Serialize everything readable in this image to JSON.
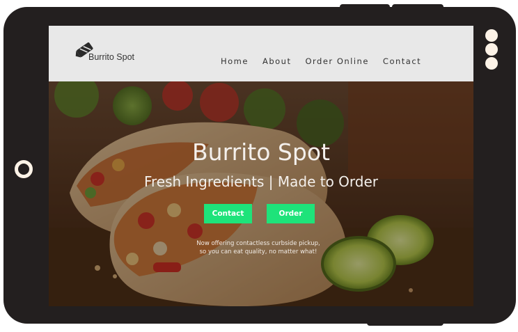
{
  "brand": {
    "name": "Burrito Spot",
    "logo_icon": "burrito-logo-icon"
  },
  "nav": {
    "items": [
      "Home",
      "About",
      "Order Online",
      "Contact"
    ]
  },
  "hero": {
    "title": "Burrito Spot",
    "subtitle": "Fresh Ingredients | Made to Order",
    "buttons": {
      "contact": "Contact",
      "order": "Order"
    },
    "note_line1": "Now offering contactless curbside pickup,",
    "note_line2": "so you can eat quality, no matter what!"
  },
  "colors": {
    "frame": "#231f1f",
    "navbar": "#e8e8e8",
    "accent": "#1ee37a",
    "hero_text": "#f4f0ec"
  },
  "device": {
    "home_button_icon": "home-ring-icon",
    "side_dots_icon": "dots-icon"
  }
}
